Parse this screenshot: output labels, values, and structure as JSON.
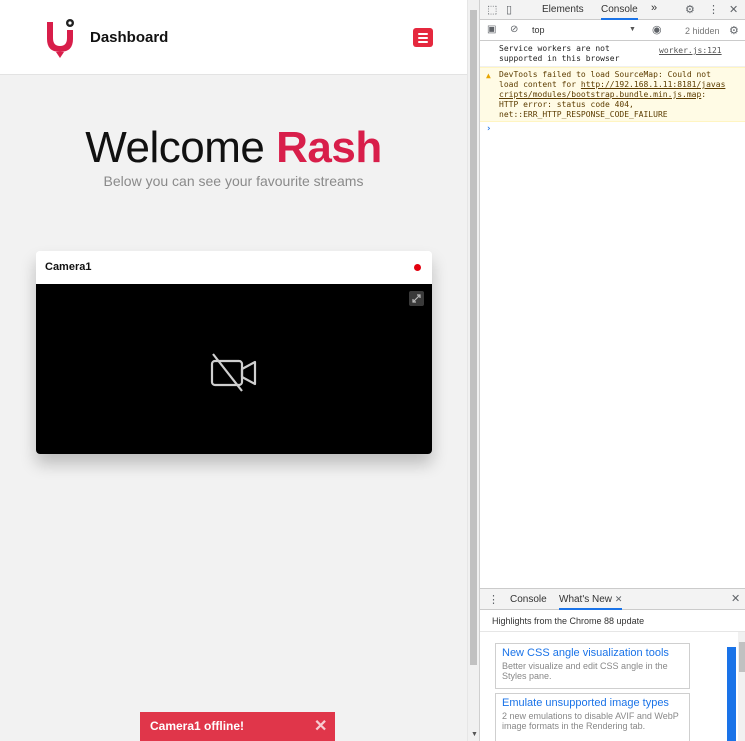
{
  "app": {
    "brand": "Dashboard",
    "welcome_prefix": "Welcome ",
    "user_name": "Rash",
    "subtitle": "Below you can see your favourite streams",
    "accent_color": "#d81e4a",
    "camera": {
      "name": "Camera1",
      "status": "offline",
      "status_color": "#e3000f"
    },
    "toast": {
      "message": "Camera1 offline!",
      "close_label": "✕"
    }
  },
  "devtools": {
    "tabs": [
      "Elements",
      "Console"
    ],
    "more_label": "»",
    "context": "top",
    "hidden_count": "2 hidden",
    "logs": {
      "info_text": "Service workers are not supported in this browser",
      "info_source": "worker.js:121",
      "warn_prefix": "DevTools failed to load SourceMap: Could not load content for ",
      "warn_url": "http://192.168.1.11:8181/javascripts/modules/bootstrap.bundle.min.js.map",
      "warn_suffix": ": HTTP error: status code 404, net::ERR_HTTP_RESPONSE_CODE_FAILURE"
    },
    "prompt": "›",
    "drawer": {
      "tabs": [
        "Console",
        "What's New"
      ],
      "tab_close": "✕",
      "close_label": "✕",
      "heading": "Highlights from the Chrome 88 update",
      "cards": [
        {
          "title": "New CSS angle visualization tools",
          "desc": "Better visualize and edit CSS angle in the Styles pane."
        },
        {
          "title": "Emulate unsupported image types",
          "desc": "2 new emulations to disable AVIF and WebP image formats in the Rendering tab."
        }
      ]
    }
  }
}
